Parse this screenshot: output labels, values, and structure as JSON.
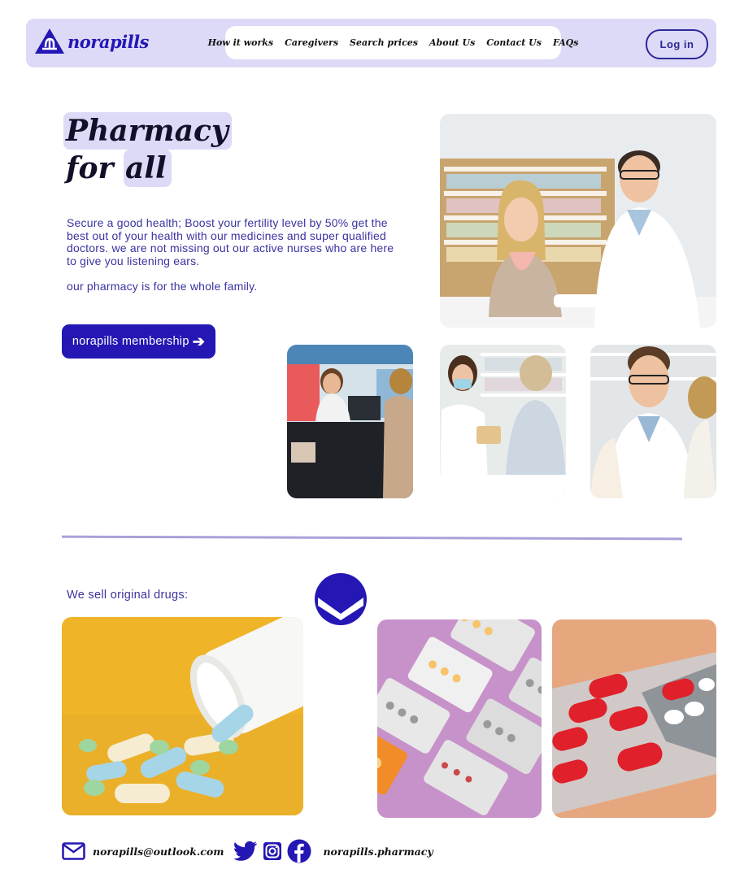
{
  "brand": {
    "name": "norapills",
    "accent": "#2417b4",
    "header_bg": "#dcdaf6"
  },
  "nav": {
    "items": [
      "How it works",
      "Caregivers",
      "Search prices",
      "About Us",
      "Contact Us",
      "FAQs"
    ],
    "login_label": "Log in"
  },
  "hero": {
    "title_line1": "Pharmacy",
    "title_line2_a": "for",
    "title_line2_b": "all",
    "description": "Secure a good health; Boost your fertility level by 50% get the best out of your health with our medicines and super qualified doctors. we are not missing out our active nurses who are here to give you listening ears.",
    "family_note": "our pharmacy is for the whole family.",
    "cta_label": "norapills membership"
  },
  "gallery": {
    "photos": [
      "pharmacist-with-customer-photo",
      "pharmacy-counter-photo",
      "pharmacist-masked-photo",
      "pharmacist-pointing-photo"
    ]
  },
  "products": {
    "heading": "We sell original drugs:",
    "photos": [
      "spilled-pills-photo",
      "blister-packs-photo",
      "red-capsules-photo"
    ]
  },
  "footer": {
    "email": "norapills@outlook.com",
    "social_icons": [
      "twitter-icon",
      "instagram-icon",
      "facebook-icon"
    ],
    "handle": "norapills.pharmacy"
  }
}
